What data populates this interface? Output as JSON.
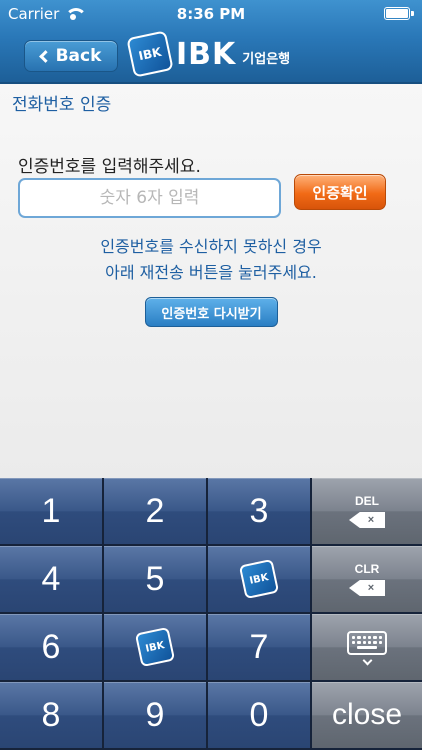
{
  "status_bar": {
    "carrier": "Carrier",
    "time": "8:36 PM",
    "wifi_icon": "wifi-icon",
    "battery_icon": "battery-icon"
  },
  "header": {
    "back_label": "Back",
    "logo_mark": "IBK",
    "logo_text": "IBK",
    "logo_sub": "기업은행"
  },
  "page": {
    "title": "전화번호 인증",
    "prompt": "인증번호를 입력해주세요.",
    "input_placeholder": "숫자 6자 입력",
    "input_value": "",
    "confirm_label": "인증확인",
    "info_line1": "인증번호를 수신하지 못하신 경우",
    "info_line2": "아래 재전송 버튼을 눌러주세요.",
    "resend_label": "인증번호 다시받기"
  },
  "keypad": {
    "r1": [
      "1",
      "2",
      "3"
    ],
    "r2": [
      "4",
      "5"
    ],
    "r3": [
      "6",
      "7"
    ],
    "r4": [
      "8",
      "9",
      "0"
    ],
    "logo_key": "IBK",
    "del_label": "DEL",
    "clr_label": "CLR",
    "close_label": "close",
    "clear_glyph": "×"
  },
  "colors": {
    "header_blue": "#2a78b8",
    "title_blue": "#1e5fa2",
    "confirm_orange": "#f16a16",
    "keypad_navy": "#2f4c7d",
    "function_gray": "#6b727d"
  }
}
